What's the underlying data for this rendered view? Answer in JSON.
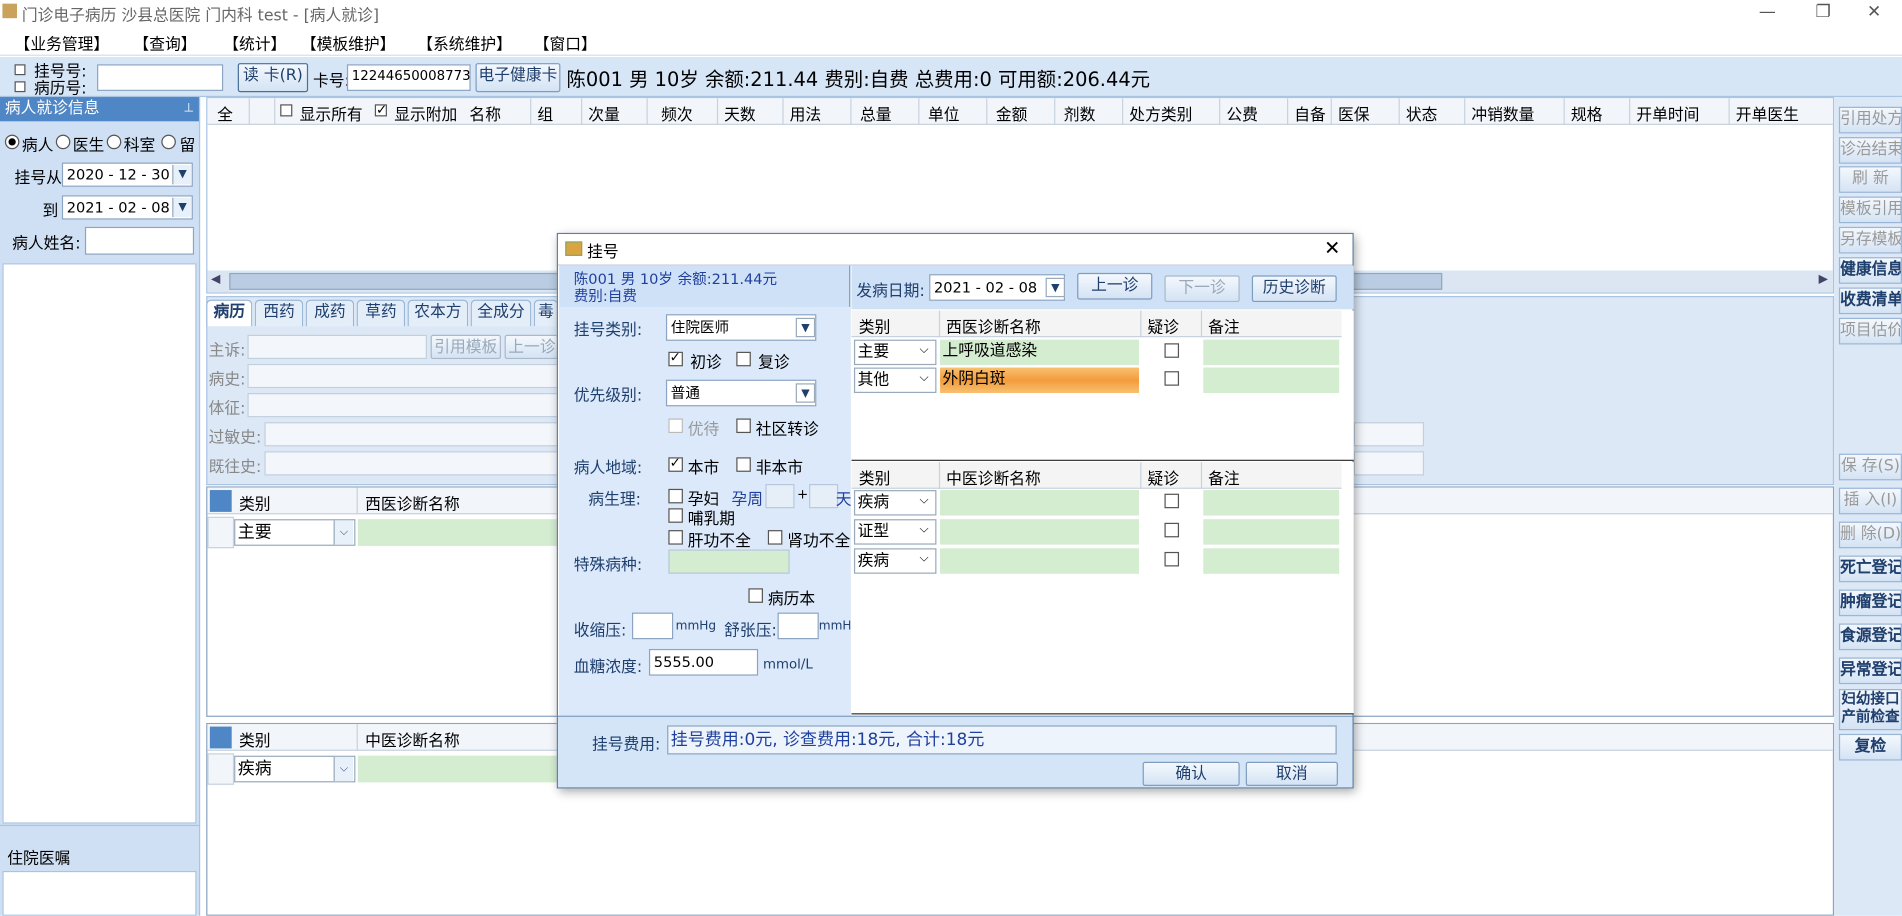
{
  "window": {
    "title": "门诊电子病历 沙县总医院 门内科 test - [病人就诊]",
    "minimize": "—",
    "restore": "❐",
    "close": "✕"
  },
  "menu": [
    "【业务管理】",
    "【查询】",
    "【统计】",
    "【模板维护】",
    "【系统维护】",
    "【窗口】"
  ],
  "toolbar": {
    "reg_no_label": "挂号号:",
    "record_no_label": "病历号:",
    "read_card": "读 卡(R)",
    "card_label": "卡号:",
    "card_value": "12244650008773",
    "e_card": "电子健康卡",
    "patient_summary": "陈001 男 10岁 余额:211.44 费别:自费 总费用:0 可用额:206.44元"
  },
  "left_panel": {
    "header": "病人就诊信息",
    "pin": "📌",
    "radios": [
      "病人",
      "医生",
      "科室",
      "留"
    ],
    "reg_from_label": "挂号从",
    "reg_from": "2020 - 12 - 30",
    "to_label": "到",
    "to": "2021 - 02 - 08",
    "name_label": "病人姓名:",
    "bottom_header": "住院医嘱"
  },
  "rx_grid": {
    "columns": [
      "全",
      "显示所有",
      "显示附加",
      "名称",
      "组",
      "次量",
      "频次",
      "天数",
      "用法",
      "总量",
      "单位",
      "金额",
      "剂数",
      "处方类别",
      "公费",
      "自备",
      "医保",
      "状态",
      "冲销数量",
      "规格",
      "开单时间",
      "开单医生"
    ]
  },
  "tabs": [
    "病历",
    "西药",
    "成药",
    "草药",
    "农本方",
    "全成分",
    "毒"
  ],
  "record_fields": {
    "complaint": "主诉:",
    "history": "病史:",
    "sign": "体征:",
    "allergy": "过敏史:",
    "past": "既往史:",
    "cite_template": "引用模板",
    "prev": "上一诊"
  },
  "wm_grid": {
    "col1": "类别",
    "col2": "西医诊断名称",
    "row_type": "主要"
  },
  "tcm_grid": {
    "col1": "类别",
    "col2": "中医诊断名称",
    "row_type": "疾病"
  },
  "side_buttons": [
    "引用处方",
    "诊治结束",
    "刷 新",
    "模板引用",
    "另存模板",
    "健康信息",
    "收费清单",
    "项目估价",
    "保 存(S)",
    "插 入(I)",
    "删 除(D)",
    "死亡登记",
    "肿瘤登记",
    "食源登记",
    "异常登记",
    "妇幼接口产前检查",
    "复检"
  ],
  "dialog": {
    "title": "挂号",
    "close": "✕",
    "patient_line1": "陈001 男 10岁 余额:211.44元",
    "patient_line2": "费别:自费",
    "reg_type_label": "挂号类别:",
    "reg_type": "住院医师",
    "first_visit": "初诊",
    "revisit": "复诊",
    "priority_label": "优先级别:",
    "priority": "普通",
    "preferential": "优待",
    "community": "社区转诊",
    "region_label": "病人地域:",
    "local": "本市",
    "nonlocal": "非本市",
    "physio_label": "病生理:",
    "pregnant": "孕妇",
    "preg_week": "孕周",
    "plus": "+",
    "day": "天",
    "lactation": "哺乳期",
    "liver": "肝功不全",
    "kidney": "肾功不全",
    "special_label": "特殊病种:",
    "record_book": "病历本",
    "sbp_label": "收缩压:",
    "dbp_label": "舒张压:",
    "mmhg": "mmHg",
    "glucose_label": "血糖浓度:",
    "glucose": "5555.00",
    "mmol": "mmol/L",
    "onset_label": "发病日期:",
    "onset": "2021 - 02 - 08",
    "prev_visit": "上一诊",
    "next_visit": "下一诊",
    "history_diag": "历史诊断",
    "wm_table": {
      "headers": [
        "类别",
        "西医诊断名称",
        "疑诊",
        "备注"
      ],
      "rows": [
        {
          "type": "主要",
          "name": "上呼吸道感染"
        },
        {
          "type": "其他",
          "name": "外阴白斑"
        }
      ]
    },
    "tcm_table": {
      "headers": [
        "类别",
        "中医诊断名称",
        "疑诊",
        "备注"
      ],
      "rows": [
        {
          "type": "疾病",
          "name": ""
        },
        {
          "type": "证型",
          "name": ""
        },
        {
          "type": "疾病",
          "name": ""
        }
      ]
    },
    "fee_label": "挂号费用:",
    "fee": "挂号费用:0元, 诊查费用:18元, 合计:18元",
    "ok": "确认",
    "cancel": "取消"
  }
}
